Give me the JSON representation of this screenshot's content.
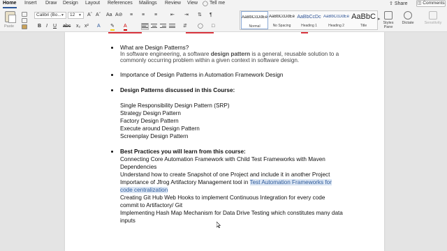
{
  "ribbon_tabs": [
    "Home",
    "Insert",
    "Draw",
    "Design",
    "Layout",
    "References",
    "Mailings",
    "Review",
    "View",
    "Tell me"
  ],
  "active_tab": "Home",
  "share_label": "Share",
  "comments_label": "Comments",
  "clipboard": {
    "paste_label": "Paste"
  },
  "font": {
    "name": "Calibri (Bo...",
    "size": "12"
  },
  "styles": [
    {
      "sample": "AaBbCcDdEe",
      "name": "Normal"
    },
    {
      "sample": "AaBbCcDdEe",
      "name": "No Spacing"
    },
    {
      "sample": "AaBbCcDc",
      "name": "Heading 1"
    },
    {
      "sample": "AaBbCcDdEe",
      "name": "Heading 2"
    },
    {
      "sample": "AaBbC",
      "name": "Title"
    }
  ],
  "side_buttons": {
    "styles_pane": "Styles Pane",
    "dictate": "Dictate",
    "sensitivity": "Sensitivity"
  },
  "document": {
    "item1_title": "What are Design Patterns?",
    "item1_desc1_pre": "In software engineering, a software ",
    "item1_desc1_bold": "design pattern",
    "item1_desc1_post": " is a general, reusable solution to a",
    "item1_desc2": "commonly occurring problem within a given context in software design.",
    "item2_title": "Importance of Design Patterns in Automation Framework Design",
    "item3_title": "Design Patterns discussed in this Course:",
    "patterns": [
      "Single Responsibility Design Pattern (SRP)",
      "Strategy Design Pattern",
      "Factory Design Pattern",
      "Execute around Design Pattern",
      "Screenplay Design Pattern"
    ],
    "item4_title": "Best Practices you will learn from this course:",
    "practices": {
      "p1a": "Connecting Core Automation Framework with Child Test Frameworks with Maven",
      "p1b": "Dependencies",
      "p2": "Understand how to create Snapshot of one Project and include it in another Project",
      "p3_pre": "Importance of Jfrog Artifactory Management tool in ",
      "p3_hl": "Test Automation Frameworks for",
      "p3b_hl": "code centralization",
      "p4a": "Creating Git Hub Web Hooks to implement Continuous Integration for every code",
      "p4b": "commit to Artifactory/ Git",
      "p5a": "Implementing Hash Map Mechanism for Data Drive Testing which constitutes many data",
      "p5b": "inputs"
    }
  },
  "colors": {
    "accent": "#2b579a",
    "highlight": "#dbe6f4",
    "highlight_text": "#2f5b9a",
    "ink_red": "#d8343d"
  }
}
